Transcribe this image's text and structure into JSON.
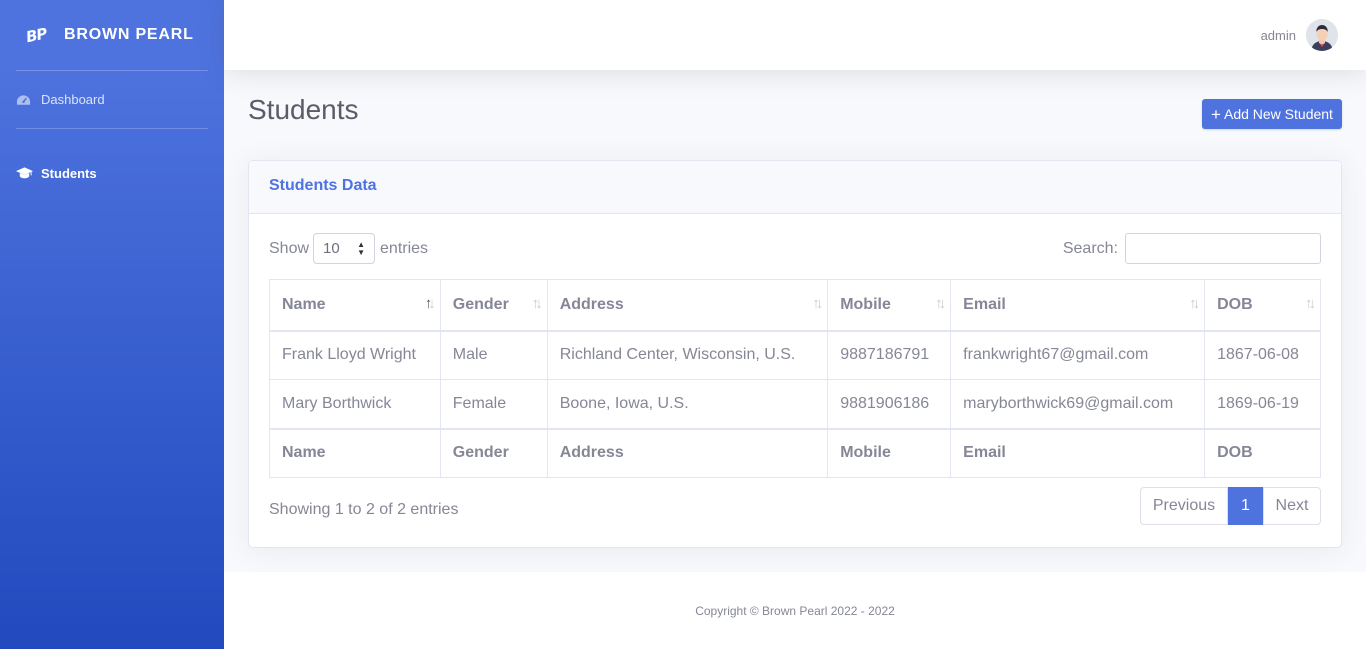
{
  "brand": {
    "logo_text": "BP",
    "name": "BROWN PEARL"
  },
  "sidebar": {
    "items": [
      {
        "label": "Dashboard",
        "icon": "gauge-icon"
      },
      {
        "label": "Students",
        "icon": "graduation-cap-icon"
      }
    ]
  },
  "topbar": {
    "user_name": "admin"
  },
  "page": {
    "title": "Students",
    "add_button": "Add New Student"
  },
  "card": {
    "title": "Students Data",
    "show_label": "Show",
    "entries_label": "entries",
    "page_length": "10",
    "search_label": "Search:",
    "search_value": ""
  },
  "table": {
    "columns": [
      "Name",
      "Gender",
      "Address",
      "Mobile",
      "Email",
      "DOB"
    ],
    "rows": [
      [
        "Frank Lloyd Wright",
        "Male",
        "Richland Center, Wisconsin, U.S.",
        "9887186791",
        "frankwright67@gmail.com",
        "1867-06-08"
      ],
      [
        "Mary Borthwick",
        "Female",
        "Boone, Iowa, U.S.",
        "9881906186",
        "maryborthwick69@gmail.com",
        "1869-06-19"
      ]
    ]
  },
  "pagination": {
    "info": "Showing 1 to 2 of 2 entries",
    "previous": "Previous",
    "current": "1",
    "next": "Next"
  },
  "footer": {
    "copyright": "Copyright © Brown Pearl 2022 - 2022"
  },
  "colors": {
    "primary": "#4e73df",
    "text": "#858796",
    "heading": "#5a5c69"
  }
}
